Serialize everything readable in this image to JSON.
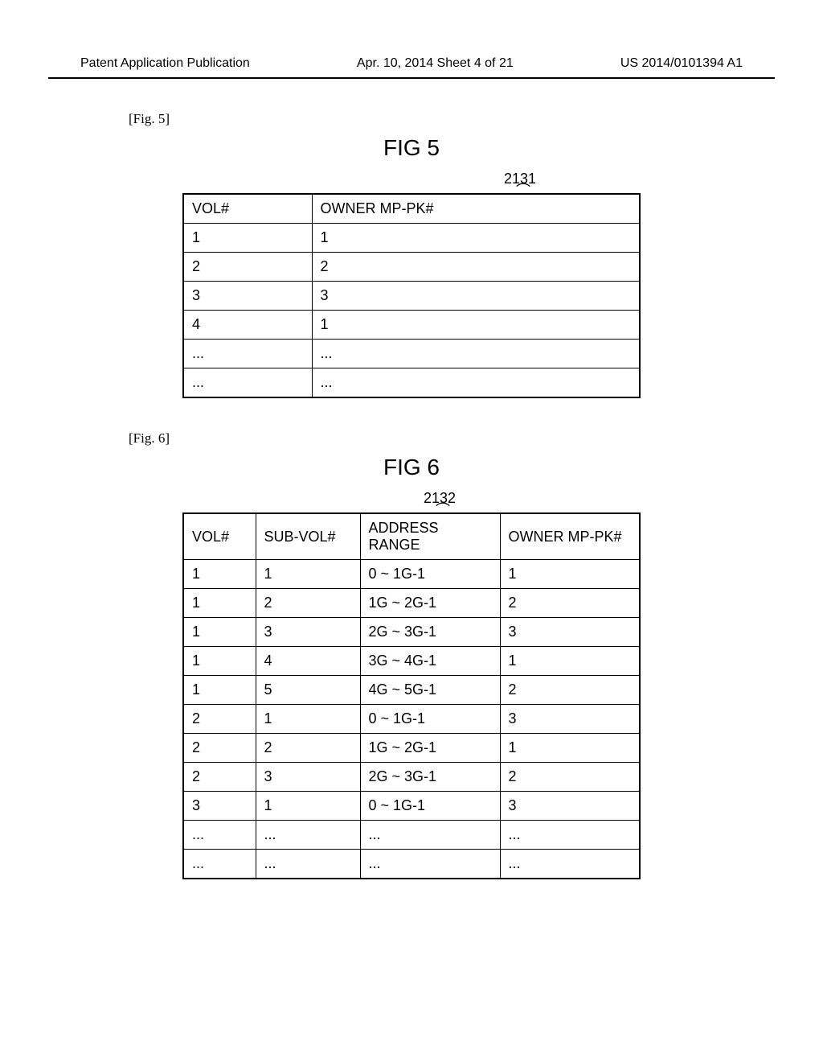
{
  "header": {
    "left": "Patent Application Publication",
    "mid": "Apr. 10, 2014  Sheet 4 of 21",
    "right": "US 2014/0101394 A1"
  },
  "fig5": {
    "label": "[Fig. 5]",
    "title": "FIG 5",
    "ref": "2131",
    "columns": [
      "VOL#",
      "OWNER MP-PK#"
    ],
    "rows": [
      [
        "1",
        "1"
      ],
      [
        "2",
        "2"
      ],
      [
        "3",
        "3"
      ],
      [
        "4",
        "1"
      ],
      [
        "...",
        "..."
      ],
      [
        "...",
        "..."
      ]
    ]
  },
  "fig6": {
    "label": "[Fig. 6]",
    "title": "FIG 6",
    "ref": "2132",
    "columns": [
      "VOL#",
      "SUB-VOL#",
      "ADDRESS RANGE",
      "OWNER MP-PK#"
    ],
    "rows": [
      [
        "1",
        "1",
        "0 ~ 1G-1",
        "1"
      ],
      [
        "1",
        "2",
        "1G ~ 2G-1",
        "2"
      ],
      [
        "1",
        "3",
        "2G ~ 3G-1",
        "3"
      ],
      [
        "1",
        "4",
        "3G ~ 4G-1",
        "1"
      ],
      [
        "1",
        "5",
        "4G ~ 5G-1",
        "2"
      ],
      [
        "2",
        "1",
        "0 ~ 1G-1",
        "3"
      ],
      [
        "2",
        "2",
        "1G ~ 2G-1",
        "1"
      ],
      [
        "2",
        "3",
        "2G ~ 3G-1",
        "2"
      ],
      [
        "3",
        "1",
        "0 ~ 1G-1",
        "3"
      ],
      [
        "...",
        "...",
        "...",
        "..."
      ],
      [
        "...",
        "...",
        "...",
        "..."
      ]
    ]
  },
  "chart_data": [
    {
      "type": "table",
      "title": "FIG 5 — Volume to Owner MP-PK mapping (ref 2131)",
      "columns": [
        "VOL#",
        "OWNER MP-PK#"
      ],
      "rows": [
        [
          "1",
          "1"
        ],
        [
          "2",
          "2"
        ],
        [
          "3",
          "3"
        ],
        [
          "4",
          "1"
        ],
        [
          "...",
          "..."
        ],
        [
          "...",
          "..."
        ]
      ]
    },
    {
      "type": "table",
      "title": "FIG 6 — Sub-volume address ranges (ref 2132)",
      "columns": [
        "VOL#",
        "SUB-VOL#",
        "ADDRESS RANGE",
        "OWNER MP-PK#"
      ],
      "rows": [
        [
          "1",
          "1",
          "0 ~ 1G-1",
          "1"
        ],
        [
          "1",
          "2",
          "1G ~ 2G-1",
          "2"
        ],
        [
          "1",
          "3",
          "2G ~ 3G-1",
          "3"
        ],
        [
          "1",
          "4",
          "3G ~ 4G-1",
          "1"
        ],
        [
          "1",
          "5",
          "4G ~ 5G-1",
          "2"
        ],
        [
          "2",
          "1",
          "0 ~ 1G-1",
          "3"
        ],
        [
          "2",
          "2",
          "1G ~ 2G-1",
          "1"
        ],
        [
          "2",
          "3",
          "2G ~ 3G-1",
          "2"
        ],
        [
          "3",
          "1",
          "0 ~ 1G-1",
          "3"
        ],
        [
          "...",
          "...",
          "...",
          "..."
        ],
        [
          "...",
          "...",
          "...",
          "..."
        ]
      ]
    }
  ]
}
